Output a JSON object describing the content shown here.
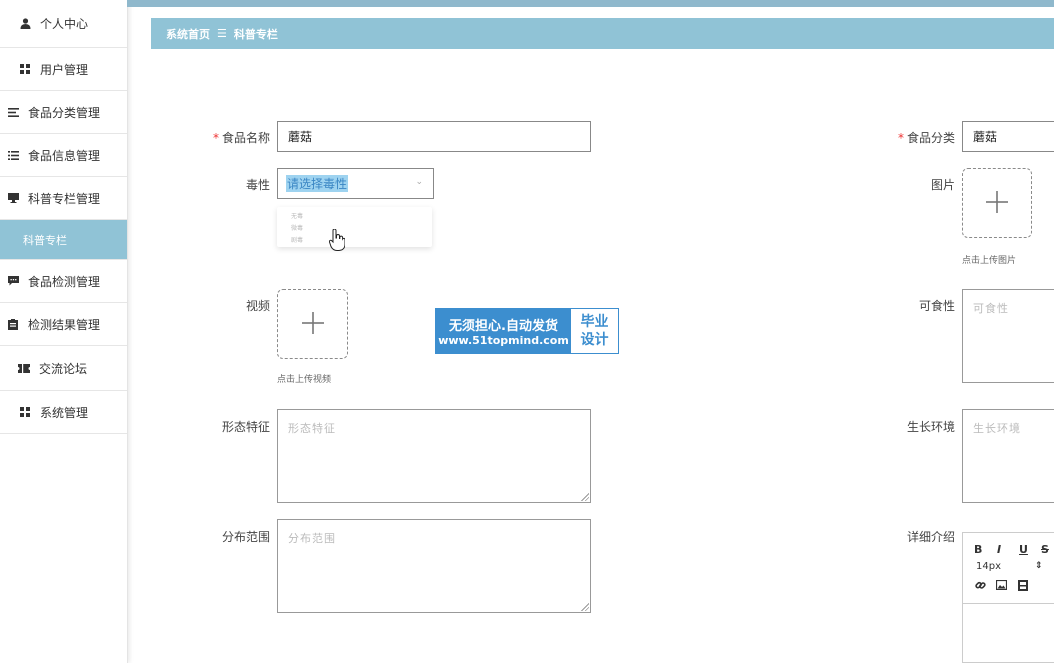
{
  "sidebar": {
    "items": [
      {
        "label": "个人中心",
        "icon": "user-icon"
      },
      {
        "label": "用户管理",
        "icon": "grid-icon"
      },
      {
        "label": "食品分类管理",
        "icon": "list-icon"
      },
      {
        "label": "食品信息管理",
        "icon": "list-icon"
      },
      {
        "label": "科普专栏管理",
        "icon": "monitor-icon"
      },
      {
        "label": "科普专栏",
        "icon": ""
      },
      {
        "label": "食品检测管理",
        "icon": "chat-icon"
      },
      {
        "label": "检测结果管理",
        "icon": "document-icon"
      },
      {
        "label": "交流论坛",
        "icon": "ticket-icon"
      },
      {
        "label": "系统管理",
        "icon": "grid-icon"
      }
    ],
    "active_index": 5
  },
  "breadcrumb": {
    "home": "系统首页",
    "separator": "☰",
    "current": "科普专栏"
  },
  "form": {
    "name_label": "食品名称",
    "name_value": "蘑菇",
    "category_label": "食品分类",
    "category_value": "蘑菇",
    "toxicity_label": "毒性",
    "toxicity_placeholder": "请选择毒性",
    "toxicity_options": [
      "无毒",
      "微毒",
      "剧毒"
    ],
    "image_label": "图片",
    "image_tip": "点击上传图片",
    "video_label": "视频",
    "video_tip": "点击上传视频",
    "edibility_label": "可食性",
    "edibility_placeholder": "可食性",
    "morphology_label": "形态特征",
    "morphology_placeholder": "形态特征",
    "habitat_label": "生长环境",
    "habitat_placeholder": "生长环境",
    "distribution_label": "分布范围",
    "distribution_placeholder": "分布范围",
    "detail_label": "详细介绍",
    "required_mark": "*"
  },
  "editor": {
    "bold": "B",
    "italic": "I",
    "underline": "U",
    "strike": "S",
    "font_size": "14px"
  },
  "watermark": {
    "line1": "无须担心.自动发货",
    "line2": "www.51topmind.com",
    "right1": "毕业",
    "right2": "设计"
  }
}
